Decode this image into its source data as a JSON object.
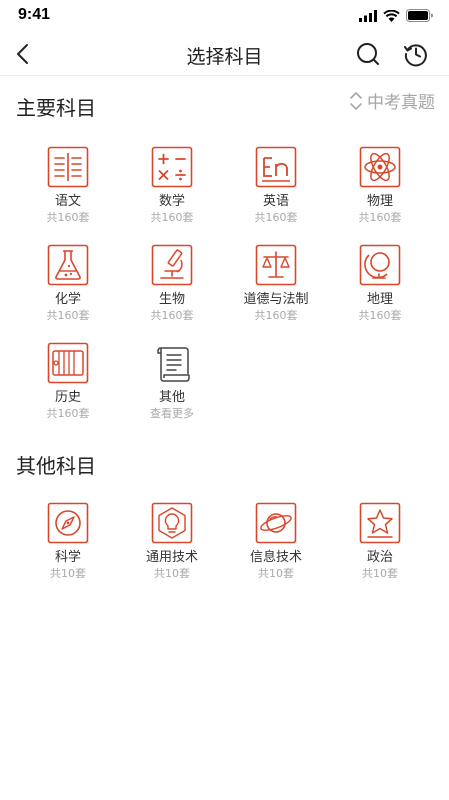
{
  "status_bar": {
    "time": "9:41"
  },
  "nav": {
    "title": "选择科目"
  },
  "colors": {
    "accent": "#d9472b",
    "muted": "#a9a9a9",
    "text": "#222222"
  },
  "main_section": {
    "title": "主要科目",
    "exam_toggle": "中考真题",
    "subjects": [
      {
        "name": "语文",
        "count": "共160套",
        "icon": "book-lines-icon"
      },
      {
        "name": "数学",
        "count": "共160套",
        "icon": "math-symbols-icon"
      },
      {
        "name": "英语",
        "count": "共160套",
        "icon": "english-en-icon"
      },
      {
        "name": "物理",
        "count": "共160套",
        "icon": "atom-icon"
      },
      {
        "name": "化学",
        "count": "共160套",
        "icon": "flask-icon"
      },
      {
        "name": "生物",
        "count": "共160套",
        "icon": "microscope-icon"
      },
      {
        "name": "道德与法制",
        "count": "共160套",
        "icon": "scales-icon"
      },
      {
        "name": "地理",
        "count": "共160套",
        "icon": "globe-icon"
      },
      {
        "name": "历史",
        "count": "共160套",
        "icon": "scroll-icon"
      },
      {
        "name": "其他",
        "count": "查看更多",
        "icon": "paper-scroll-icon"
      }
    ]
  },
  "other_section": {
    "title": "其他科目",
    "subjects": [
      {
        "name": "科学",
        "count": "共10套",
        "icon": "compass-icon"
      },
      {
        "name": "通用技术",
        "count": "共10套",
        "icon": "lightbulb-gear-icon"
      },
      {
        "name": "信息技术",
        "count": "共10套",
        "icon": "planet-icon"
      },
      {
        "name": "政治",
        "count": "共10套",
        "icon": "star-icon"
      }
    ]
  }
}
